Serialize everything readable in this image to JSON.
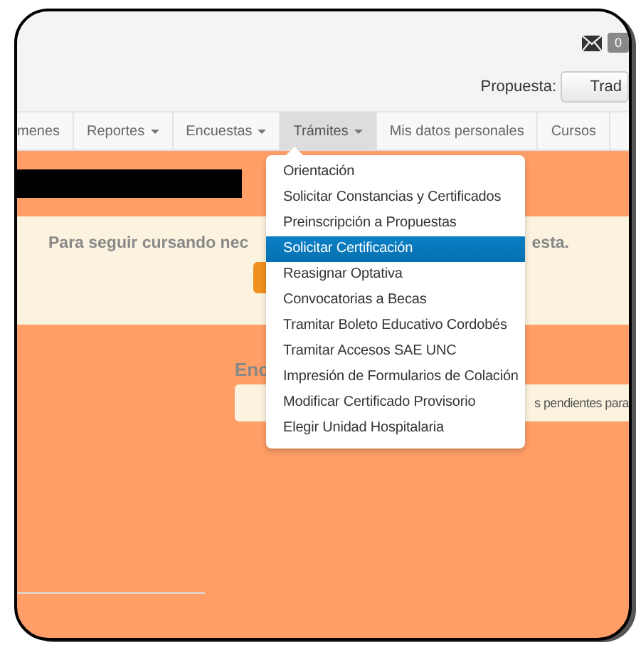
{
  "header": {
    "mail_count": "0",
    "proposal_label": "Propuesta:",
    "proposal_button": "Trad"
  },
  "nav": [
    {
      "label": "menes",
      "dropdown": false,
      "selected": false
    },
    {
      "label": "Reportes",
      "dropdown": true,
      "selected": false
    },
    {
      "label": "Encuestas",
      "dropdown": true,
      "selected": false
    },
    {
      "label": "Trámites",
      "dropdown": true,
      "selected": true
    },
    {
      "label": "Mis datos personales",
      "dropdown": false,
      "selected": false
    },
    {
      "label": "Cursos",
      "dropdown": false,
      "selected": false
    }
  ],
  "menu": [
    {
      "label": "Orientación",
      "selected": false
    },
    {
      "label": "Solicitar Constancias y Certificados",
      "selected": false
    },
    {
      "label": "Preinscripción a Propuestas",
      "selected": false
    },
    {
      "label": "Solicitar Certificación",
      "selected": true
    },
    {
      "label": "Reasignar Optativa",
      "selected": false
    },
    {
      "label": "Convocatorias a Becas",
      "selected": false
    },
    {
      "label": "Tramitar Boleto Educativo Cordobés",
      "selected": false
    },
    {
      "label": "Tramitar Accesos SAE UNC",
      "selected": false
    },
    {
      "label": "Impresión de Formularios de Colación",
      "selected": false
    },
    {
      "label": "Modificar Certificado Provisorio",
      "selected": false
    },
    {
      "label": "Elegir Unidad Hospitalaria",
      "selected": false
    }
  ],
  "alert": {
    "text_left": "Para seguir cursando nec",
    "text_right": "esta."
  },
  "section": {
    "heading": "Enc",
    "notice": "s pendientes para"
  }
}
